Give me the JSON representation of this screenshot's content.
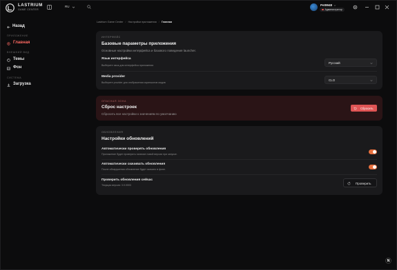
{
  "header": {
    "brand_name": "LASTRIUM",
    "brand_sub": "GAME CENTER",
    "language": "RU",
    "user": {
      "name": "Pet9948",
      "role": "Администратор"
    }
  },
  "sidebar": {
    "back_label": "Назад",
    "sections": [
      {
        "label": "ПРИЛОЖЕНИЕ",
        "items": [
          {
            "label": "Главная",
            "icon": "settings-icon",
            "active": true
          }
        ]
      },
      {
        "label": "ВНЕШНИЙ ВИД",
        "items": [
          {
            "label": "Темы",
            "icon": "palette-icon"
          },
          {
            "label": "Фон",
            "icon": "image-icon"
          }
        ]
      },
      {
        "label": "СИСТЕМА",
        "items": [
          {
            "label": "Загрузка",
            "icon": "download-icon"
          }
        ]
      }
    ]
  },
  "breadcrumb": [
    "Lastrium Game Center",
    "Настройки приложения",
    "Главная"
  ],
  "interface_card": {
    "eyebrow": "ИНТЕРФЕЙС",
    "title": "Базовые параметры приложения",
    "description": "Основные настройки интерфейса и базового поведения launcher.",
    "language_row": {
      "title": "Язык интерфейса",
      "description": "Выберите язык для интерфейса приложения",
      "value": "Русский"
    },
    "media_row": {
      "title": "Media provider",
      "description": "Выберите provider для отображения скриншотов модов",
      "value": "CLO"
    }
  },
  "danger_card": {
    "eyebrow": "ОПАСНАЯ ЗОНА",
    "title": "Сброс настроек",
    "description": "Сбросить все настройки к значениям по умолчанию",
    "button": "Сбросить"
  },
  "updates_card": {
    "eyebrow": "ОБНОВЛЕНИЯ",
    "title": "Настройки обновлений",
    "auto_check": {
      "title": "Автоматически проверять обновления",
      "description": "Приложение будет проверять наличие новой версии при запуске.",
      "enabled": true
    },
    "auto_download": {
      "title": "Автоматически скачивать обновления",
      "description": "После обнаружения обновление будет скачано в фоне.",
      "enabled": true
    },
    "check_now": {
      "title": "Проверить обновления сейчас",
      "description": "Текущая версия: 3.0.0003",
      "button": "Проверить"
    }
  },
  "colors": {
    "accent": "#e8703e",
    "danger": "#e05555",
    "active_nav": "#ff6a63"
  },
  "dev_badge": "N"
}
